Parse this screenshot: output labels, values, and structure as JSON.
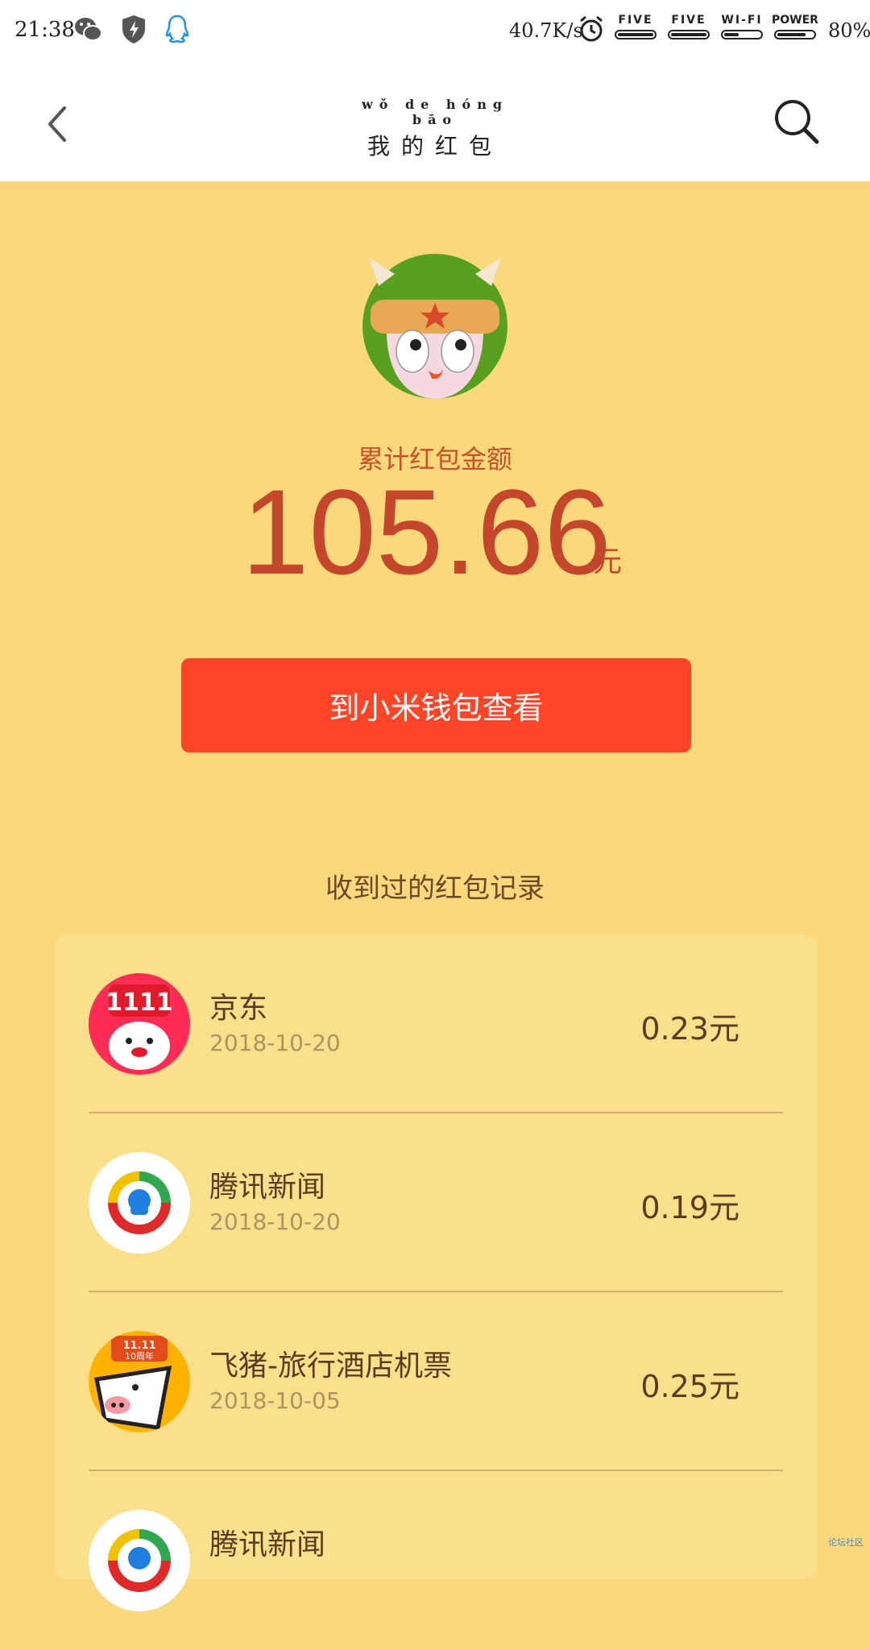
{
  "status_bar": {
    "time": "21:38",
    "speed": "40.7K/s",
    "signal1": "FIVE",
    "signal2": "FIVE",
    "wifi": "WI-FI",
    "power": "POWER",
    "battery_percent": "80%",
    "icons": [
      "wechat-icon",
      "shield-icon",
      "qq-icon",
      "alarm-icon"
    ],
    "battery_level": 0.8
  },
  "header": {
    "pinyin": "wǒ  de  hóng bāo",
    "title": "我的红包",
    "icons": [
      "back-chevron-icon",
      "search-icon"
    ]
  },
  "summary": {
    "label": "累计红包金额",
    "amount": "105.66",
    "unit": "元",
    "wallet_button": "到小米钱包查看"
  },
  "history": {
    "title": "收到过的红包记录",
    "items": [
      {
        "name": "京东",
        "date": "2018-10-20",
        "amount": "0.23元",
        "icon": "jd-logo-icon"
      },
      {
        "name": "腾讯新闻",
        "date": "2018-10-20",
        "amount": "0.19元",
        "icon": "tencent-news-logo-icon"
      },
      {
        "name": "飞猪-旅行酒店机票",
        "date": "2018-10-05",
        "amount": "0.25元",
        "icon": "fliggy-logo-icon"
      },
      {
        "name": "腾讯新闻",
        "date": "",
        "amount": "",
        "icon": "tencent-news-logo-icon"
      }
    ]
  },
  "watermark": "论坛社区",
  "colors": {
    "background": "#fbd87c",
    "card": "#fcdf8b",
    "button": "#fe4527",
    "amount": "#c4462b"
  }
}
